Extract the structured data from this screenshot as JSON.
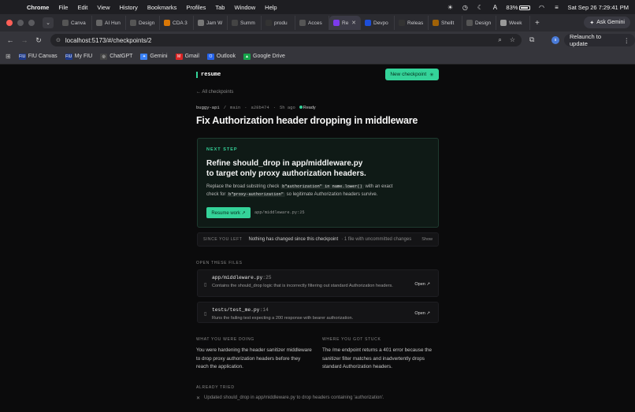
{
  "menubar": {
    "app": "Chrome",
    "items": [
      "File",
      "Edit",
      "View",
      "History",
      "Bookmarks",
      "Profiles",
      "Tab",
      "Window",
      "Help"
    ],
    "battery": "83%",
    "clock": "Sat Sep 26  7:29:41 PM"
  },
  "tabs": [
    {
      "label": "Canva",
      "icon": "canvas-icon",
      "color": "#555"
    },
    {
      "label": "AI Hun",
      "icon": "ai-icon",
      "color": "#666"
    },
    {
      "label": "Design",
      "icon": "chrome-icon",
      "color": "#555"
    },
    {
      "label": "CDA 3",
      "icon": "zy-icon",
      "color": "#d97706"
    },
    {
      "label": "Jam W",
      "icon": "doc-icon",
      "color": "#777"
    },
    {
      "label": "Summ",
      "icon": "chatgpt-icon",
      "color": "#444"
    },
    {
      "label": "produ",
      "icon": "github-icon",
      "color": "#333"
    },
    {
      "label": "Acces",
      "icon": "chrome-icon",
      "color": "#555"
    },
    {
      "label": "Re",
      "icon": "app-icon",
      "color": "#7c3aed",
      "active": true
    },
    {
      "label": "Devpo",
      "icon": "devpost-icon",
      "color": "#1d4ed8"
    },
    {
      "label": "Releas",
      "icon": "github-icon",
      "color": "#333"
    },
    {
      "label": "Shellt",
      "icon": "shell-icon",
      "color": "#a16207"
    },
    {
      "label": "Design",
      "icon": "chrome-icon",
      "color": "#555"
    },
    {
      "label": "Week",
      "icon": "claude-icon",
      "color": "#999"
    }
  ],
  "toolbar": {
    "url": "localhost:5173/#/checkpoints/2",
    "relaunch_label": "Relaunch to update",
    "ask_gemini": "Ask Gemini",
    "profile_initial": "s"
  },
  "bookmarks": [
    {
      "label": "FIU Canvas",
      "color": "#1e3a8a",
      "abbr": "FIU"
    },
    {
      "label": "My FIU",
      "color": "#1e3a8a",
      "abbr": "FIU"
    },
    {
      "label": "ChatGPT",
      "color": "#444",
      "abbr": "◎"
    },
    {
      "label": "Gemini",
      "color": "#3b82f6",
      "abbr": "✦"
    },
    {
      "label": "Gmail",
      "color": "#dc2626",
      "abbr": "M"
    },
    {
      "label": "Outlook",
      "color": "#2563eb",
      "abbr": "O"
    },
    {
      "label": "Google Drive",
      "color": "#16a34a",
      "abbr": "▲"
    }
  ],
  "app": {
    "brand": "resume",
    "new_checkpoint": "New checkpoint",
    "all_checkpoints": "← All checkpoints",
    "meta": {
      "repo": "buggy-api",
      "branch": "main",
      "commit": "a28b474",
      "age": "5h ago",
      "status": "Ready"
    },
    "title": "Fix Authorization header dropping in middleware",
    "next_step": {
      "label": "NEXT STEP",
      "headline_1": "Refine should_drop in app/middleware.py",
      "headline_2": "to target only proxy authorization headers.",
      "body_1": "Replace the broad substring check ",
      "code_1": "b\"authorization\" in name.lower()",
      "body_2": " with an exact",
      "body_3": "check for ",
      "code_2": "b\"proxy-authorization\"",
      "body_4": " so legitimate Authorization headers survive.",
      "button": "Resume work ↗",
      "path": "app/middleware.py:25"
    },
    "since": {
      "label": "SINCE YOU LEFT",
      "message": "Nothing has changed since this checkpoint",
      "sub": "· 1 file with uncommitted changes",
      "show": "Show"
    },
    "open_files_label": "OPEN THESE FILES",
    "files": [
      {
        "name": "app/middleware.py",
        "line": ":25",
        "desc": "Contains the should_drop logic that is incorrectly filtering out standard Authorization headers.",
        "open": "Open ↗"
      },
      {
        "name": "tests/test_me.py",
        "line": ":14",
        "desc": "Runs the failing test expecting a 200 response with bearer authorization.",
        "open": "Open ↗"
      }
    ],
    "doing": {
      "label": "WHAT YOU WERE DOING",
      "text": "You were hardening the header sanitizer middleware to drop proxy authorization headers before they reach the application."
    },
    "stuck": {
      "label": "WHERE YOU GOT STUCK",
      "text": "The /me endpoint returns a 401 error because the sanitizer filter matches and inadvertently drops standard Authorization headers."
    },
    "tried": {
      "label": "ALREADY TRIED",
      "item": "Updated should_drop in app/middleware.py to drop headers containing 'authorization'."
    }
  }
}
